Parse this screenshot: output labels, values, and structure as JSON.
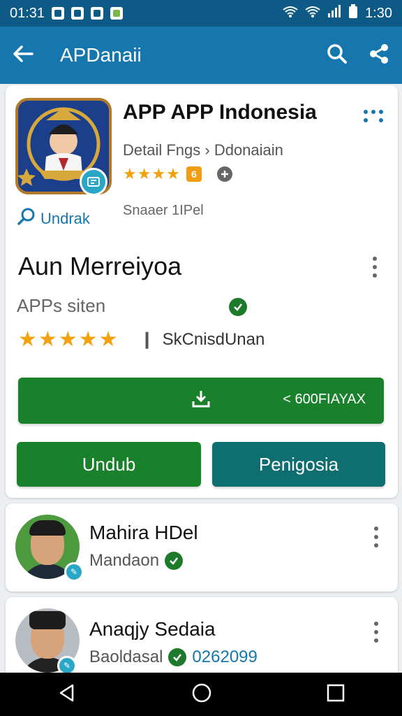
{
  "status_bar": {
    "time_left": "01:31",
    "time_right": "1:30"
  },
  "app_bar": {
    "title": "APDanaii",
    "back_icon": "arrow-left-icon",
    "search_icon": "search-icon",
    "share_icon": "share-icon"
  },
  "app_card": {
    "name": "APP APP Indonesia",
    "developer": "Detail Fngs › Ddonaiain",
    "stars": "★★★★",
    "rating_badge": "6",
    "meta": "Snaaer 1IPel",
    "link_label": "Undrak",
    "section_title": "Aun Merreiyoa",
    "subtitle": "APPs siten",
    "stars_big": "★★★★★",
    "rating_label": "SkCnisdUnan",
    "install_label": "< 600FIAYAX",
    "button_primary": "Undub",
    "button_secondary": "Penigosia"
  },
  "contacts": [
    {
      "name": "Mahira HDel",
      "subtitle": "Mandaon",
      "number": ""
    },
    {
      "name": "Anaqjy Sedaia",
      "subtitle": "Baoldasal",
      "number": "0262099"
    }
  ],
  "colors": {
    "status_bar": "#0d5a86",
    "app_bar": "#1577ad",
    "primary_green": "#19812b",
    "secondary_teal": "#0f6e70",
    "star": "#f2a20f"
  }
}
